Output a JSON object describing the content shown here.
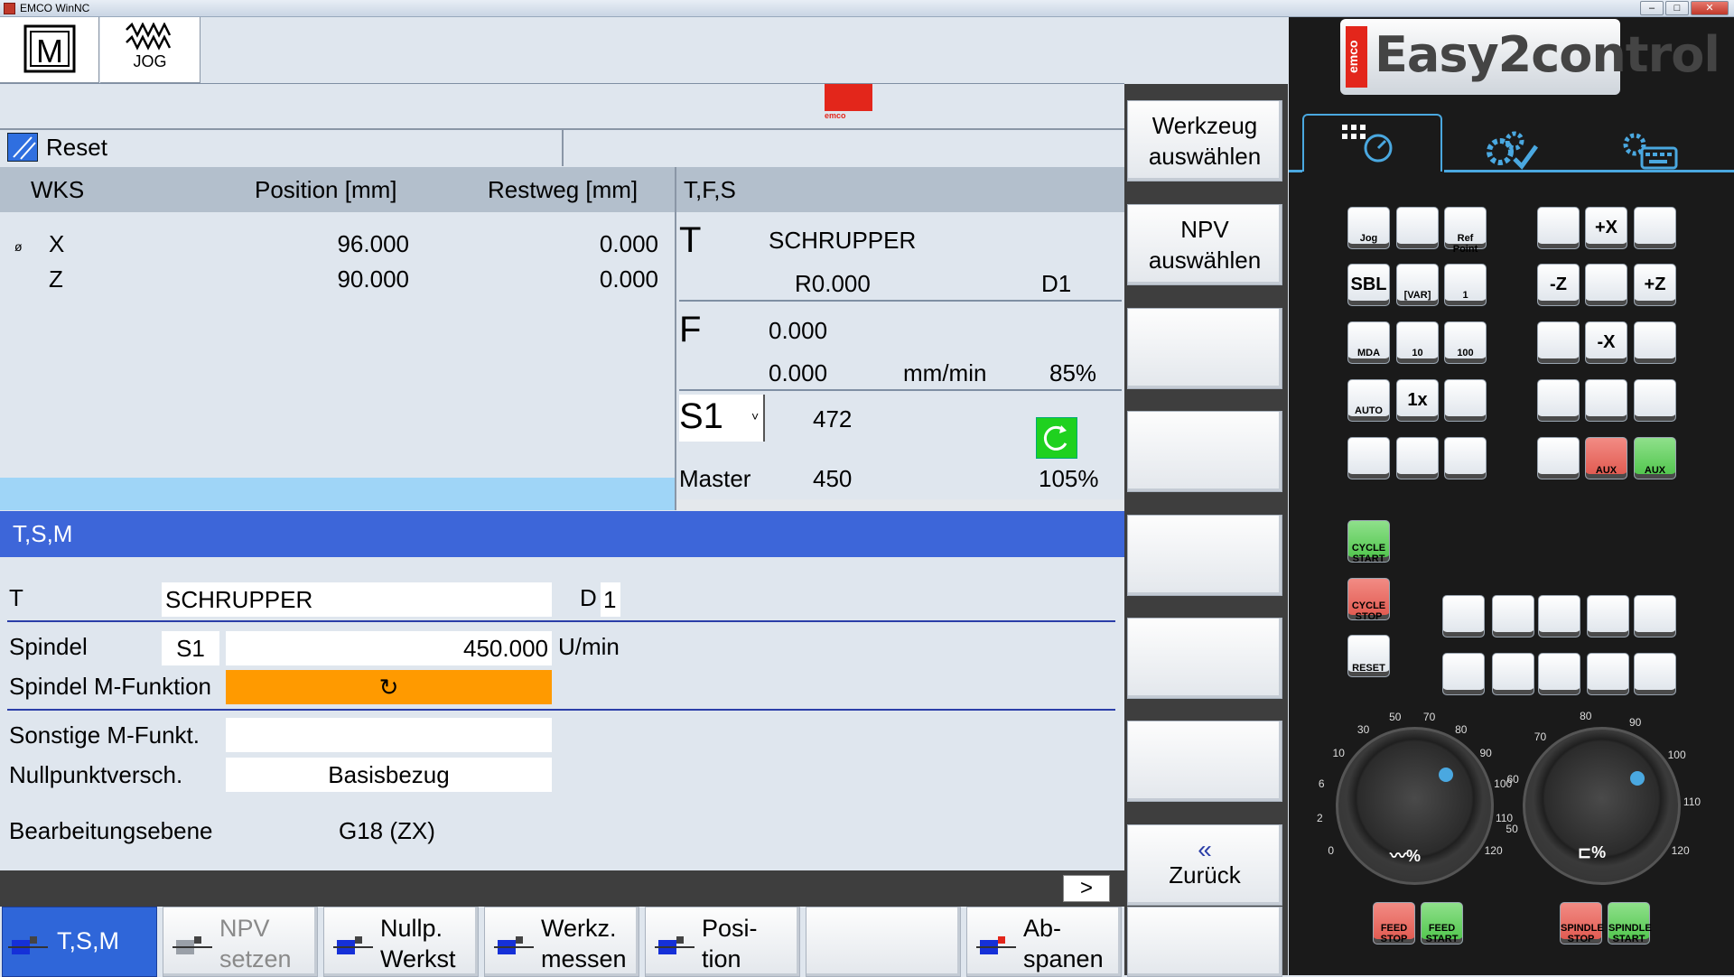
{
  "window": {
    "title": "EMCO WinNC"
  },
  "modes": {
    "m": "M",
    "jog": "JOG"
  },
  "status": {
    "text": "Reset"
  },
  "pos": {
    "headers": {
      "wks": "WKS",
      "position": "Position [mm]",
      "restweg": "Restweg [mm]"
    },
    "axes": [
      {
        "marker": "ø",
        "axis": "X",
        "position": "96.000",
        "restweg": "0.000"
      },
      {
        "marker": "",
        "axis": "Z",
        "position": "90.000",
        "restweg": "0.000"
      }
    ]
  },
  "tfs": {
    "title": "T,F,S",
    "t_label": "T",
    "tool": "SCHRUPPER",
    "radius": "R0.000",
    "d": "D1",
    "f_label": "F",
    "feed": "0.000",
    "feed2": "0.000",
    "feed_unit": "mm/min",
    "feed_pct": "85%",
    "s_label": "S1",
    "s_caret": "˅",
    "speed": "472",
    "master_label": "Master",
    "master_speed": "450",
    "spindle_pct": "105%"
  },
  "tsm": {
    "title": "T,S,M",
    "t_label": "T",
    "tool": "SCHRUPPER",
    "d_label": "D",
    "d_value": "1",
    "spindel_label": "Spindel",
    "spindel_value": "S1",
    "spindel_speed": "450.000",
    "spindel_unit": "U/min",
    "mfunc_label": "Spindel M-Funktion",
    "mfunc_icon": "↻",
    "sonst_label": "Sonstige M-Funkt.",
    "sonst_value": "",
    "npv_label": "Nullpunktversch.",
    "npv_value": "Basisbezug",
    "ebene_label": "Bearbeitungsebene",
    "ebene_value": "G18 (ZX)"
  },
  "more_button": ">",
  "vsoftkeys": [
    {
      "l1": "Werkzeug",
      "l2": "auswählen"
    },
    {
      "l1": "NPV",
      "l2": "auswählen"
    },
    {
      "l1": "",
      "l2": ""
    },
    {
      "l1": "",
      "l2": ""
    },
    {
      "l1": "",
      "l2": ""
    },
    {
      "l1": "",
      "l2": ""
    },
    {
      "l1": "",
      "l2": ""
    },
    {
      "l1": "«",
      "l2": "Zurück"
    }
  ],
  "hsoftkeys": [
    {
      "l1": "T,S,M",
      "l2": ""
    },
    {
      "l1": "NPV",
      "l2": "setzen"
    },
    {
      "l1": "Nullp.",
      "l2": "Werkst"
    },
    {
      "l1": "Werkz.",
      "l2": "messen"
    },
    {
      "l1": "Posi-",
      "l2": "tion"
    },
    {
      "l1": "",
      "l2": ""
    },
    {
      "l1": "Ab-",
      "l2": "spanen"
    },
    {
      "l1": "",
      "l2": ""
    }
  ],
  "panel": {
    "brand": "emco",
    "logo": "Easy2control",
    "keys": {
      "jog": "Jog",
      "refpoint": "Ref Point",
      "sbl": "SBL",
      "var": "[VAR]",
      "one": "1",
      "mda": "MDA",
      "ten": "10",
      "hundred": "100",
      "auto": "AUTO",
      "onex": "1x",
      "plus_x": "+X",
      "minus_z": "-Z",
      "plus_z": "+Z",
      "minus_x": "-X",
      "aux": "AUX",
      "cycle_start": "CYCLE START",
      "cycle_stop": "CYCLE STOP",
      "reset": "RESET",
      "feed_stop": "FEED STOP",
      "feed_start": "FEED START",
      "spindle_stop": "SPINDLE STOP",
      "spindle_start": "SPINDLE START"
    },
    "feed_dial": {
      "ticks": [
        "0",
        "2",
        "6",
        "10",
        "30",
        "50",
        "70",
        "80",
        "90",
        "100",
        "110",
        "120"
      ],
      "label": "%"
    },
    "spindle_dial": {
      "ticks": [
        "50",
        "60",
        "70",
        "80",
        "90",
        "100",
        "110",
        "120"
      ],
      "label": "%"
    }
  }
}
